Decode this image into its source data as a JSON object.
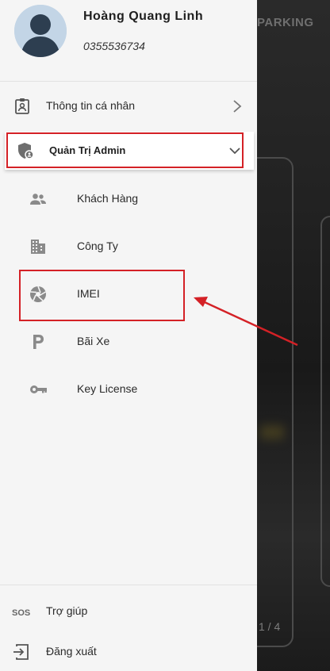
{
  "background": {
    "brand": "PARKING",
    "pager": "1 / 4"
  },
  "profile": {
    "name": "Hoàng Quang Linh",
    "phone": "0355536734"
  },
  "menu": {
    "personal_info": "Thông tin cá nhân",
    "admin": "Quản Trị Admin",
    "admin_items": [
      {
        "label": "Khách Hàng",
        "icon": "people-icon"
      },
      {
        "label": "Công Ty",
        "icon": "building-icon"
      },
      {
        "label": "IMEI",
        "icon": "camera-shutter-icon"
      },
      {
        "label": "Bãi Xe",
        "icon": "parking-icon"
      },
      {
        "label": "Key License",
        "icon": "key-icon"
      }
    ]
  },
  "footer": {
    "help": "Trợ giúp",
    "help_icon": "SOS",
    "logout": "Đăng xuất"
  },
  "colors": {
    "highlight": "#d42126",
    "drawer_bg": "#f5f5f5",
    "icon_grey": "#8a8a8a"
  }
}
